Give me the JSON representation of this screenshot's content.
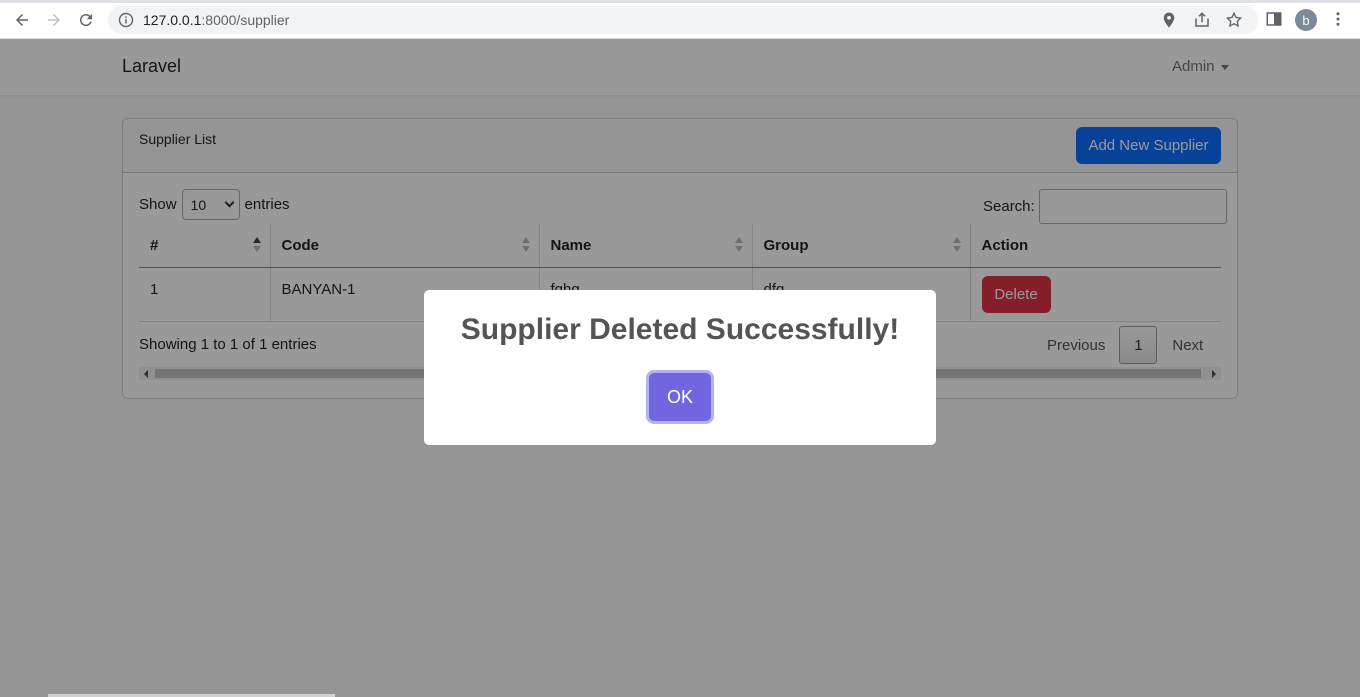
{
  "browser": {
    "url_host": "127.0.0.1",
    "url_path": ":8000/supplier",
    "profile_initial": "b"
  },
  "navbar": {
    "brand": "Laravel",
    "user_menu": "Admin"
  },
  "card": {
    "title": "Supplier List",
    "add_button": "Add New Supplier"
  },
  "table_controls": {
    "show_label": "Show",
    "page_length": "10",
    "entries_label": "entries",
    "search_label": "Search:",
    "search_value": ""
  },
  "table": {
    "columns": [
      "#",
      "Code",
      "Name",
      "Group",
      "Action"
    ],
    "rows": [
      {
        "num": "1",
        "code": "BANYAN-1",
        "name": "fghg",
        "group": "dfg",
        "action": "Delete"
      }
    ]
  },
  "footer": {
    "info": "Showing 1 to 1 of 1 entries",
    "previous": "Previous",
    "current_page": "1",
    "next": "Next"
  },
  "modal": {
    "title": "Supplier Deleted Successfully!",
    "ok_button": "OK"
  },
  "colors": {
    "primary": "#0d6efd",
    "danger": "#dc3545",
    "confirm": "#7066e0"
  }
}
